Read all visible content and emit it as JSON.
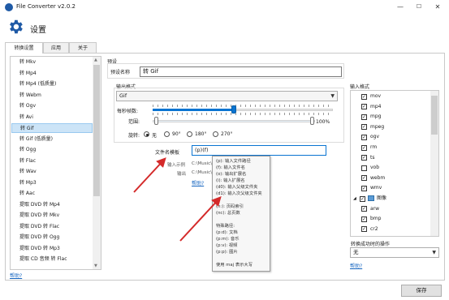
{
  "window": {
    "title": "File Converter v2.0.2",
    "minimize": "—",
    "maximize": "☐",
    "close": "✕"
  },
  "header": {
    "title": "设置"
  },
  "tabs": [
    {
      "label": "转换设置",
      "active": true
    },
    {
      "label": "应用",
      "active": false
    },
    {
      "label": "关于",
      "active": false
    }
  ],
  "conversions": {
    "items": [
      "转 Mkv",
      "转 Mp4",
      "转 Mp4 (低质量)",
      "转 Webm",
      "转 Ogv",
      "转 Avi",
      "转 Gif",
      "转 Gif (低质量)",
      "转 Ogg",
      "转 Flac",
      "转 Wav",
      "转 Mp3",
      "转 Aac",
      "提取 DVD 转 Mp4",
      "提取 DVD 转 Mkv",
      "提取 DVD 转 Flac",
      "提取 DVD 转 Ogg",
      "提取 DVD 转 Mp3",
      "提取 CD 音频 转 Flac"
    ],
    "selected_index": 6,
    "help_link": "帮助?"
  },
  "preset": {
    "group_label": "预设",
    "name_label": "预设名称",
    "name_value": "转 Gif"
  },
  "output_format": {
    "group_label": "输出格式",
    "format_value": "Gif",
    "fps_label": "每秒帧数:",
    "range_label": "范围:",
    "range_percent": "100%",
    "fps_slider_fraction": 0.45,
    "rotation_label": "旋转:",
    "rotation_options": [
      {
        "label": "无",
        "selected": true
      },
      {
        "label": "90°",
        "selected": false
      },
      {
        "label": "180°",
        "selected": false
      },
      {
        "label": "270°",
        "selected": false
      }
    ]
  },
  "filename": {
    "template_label": "文件名模板",
    "template_value": "(p)(f)",
    "input_example_label": "输入示例",
    "input_example_value": "C:\\Music\\",
    "output_label": "输出",
    "output_value": "C:\\Music\\",
    "help_link": "帮助?"
  },
  "tooltip": {
    "lines": [
      "(p): 输入文件路径",
      "(f): 输入文件名",
      "(o): 输出扩展名",
      "(i): 输入扩展名",
      "(d0): 输入父级文件夹",
      "(d1): 输入次父级文件夹",
      "...",
      "(n:): 页码索引",
      "(nc): 总页数",
      "",
      "特殊路径:",
      "(p:d): 文档",
      "(p:m): 音乐",
      "(p:v): 视频",
      "(p:p): 图片",
      "",
      "使用 maj 表示大写"
    ]
  },
  "input_formats": {
    "group_label": "输入格式",
    "items": [
      {
        "label": "mov",
        "checked": true,
        "type": "item"
      },
      {
        "label": "mp4",
        "checked": true,
        "type": "item"
      },
      {
        "label": "mpg",
        "checked": true,
        "type": "item"
      },
      {
        "label": "mpeg",
        "checked": true,
        "type": "item"
      },
      {
        "label": "ogv",
        "checked": true,
        "type": "item"
      },
      {
        "label": "rm",
        "checked": true,
        "type": "item"
      },
      {
        "label": "ts",
        "checked": true,
        "type": "item"
      },
      {
        "label": "vob",
        "checked": false,
        "type": "item"
      },
      {
        "label": "webm",
        "checked": true,
        "type": "item"
      },
      {
        "label": "wmv",
        "checked": true,
        "type": "item"
      },
      {
        "label": "图像",
        "checked": true,
        "type": "category"
      },
      {
        "label": "arw",
        "checked": true,
        "type": "item"
      },
      {
        "label": "bmp",
        "checked": true,
        "type": "item"
      },
      {
        "label": "cr2",
        "checked": true,
        "type": "item"
      }
    ]
  },
  "post_conversion": {
    "label": "转换成功时的操作",
    "value": "无",
    "help_link": "帮助?"
  },
  "footer": {
    "save_label": "保存"
  },
  "colors": {
    "accent": "#0a74d1",
    "arrow": "#d42a2a",
    "selection": "#cce4f7"
  }
}
